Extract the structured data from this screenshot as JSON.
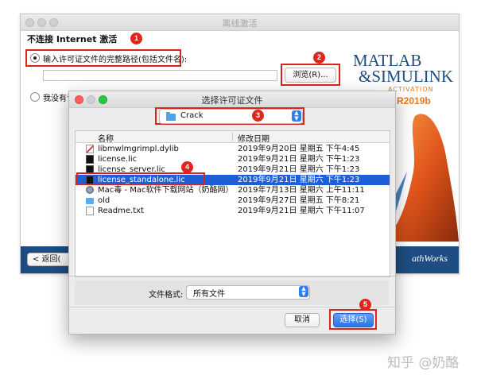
{
  "background_window": {
    "title": "离线激活",
    "heading": "不连接 Internet 激活",
    "option_license_path": "输入许可证文件的完整路径(包括文件名):",
    "option_no_license": "我没有许",
    "browse_button": "浏览(R)...",
    "back_button": "< 返回(",
    "logo_matlab": "MATLAB",
    "logo_simulink": "&SIMULINK",
    "logo_activation": "ACTIVATION",
    "logo_release": "R2019b",
    "footer_brand": "athWorks"
  },
  "dialog": {
    "title": "选择许可证文件",
    "location": "Crack",
    "columns": {
      "name": "名称",
      "modified": "修改日期"
    },
    "files": [
      {
        "name": "libmwlmgrimpl.dylib",
        "date": "2019年9月20日 星期五 下午4:45",
        "icon": "dylib-icon",
        "selected": false
      },
      {
        "name": "license.lic",
        "date": "2019年9月21日 星期六 下午1:23",
        "icon": "license-file-icon",
        "selected": false
      },
      {
        "name": "license_server.lic",
        "date": "2019年9月21日 星期六 下午1:23",
        "icon": "license-file-icon",
        "selected": false
      },
      {
        "name": "license_standalone.lic",
        "date": "2019年9月21日 星期六 下午1:23",
        "icon": "license-file-icon",
        "selected": true
      },
      {
        "name": "Mac毒 - Mac软件下载网站（奶酪网）",
        "date": "2019年7月13日 星期六 上午11:11",
        "icon": "disk-icon",
        "selected": false
      },
      {
        "name": "old",
        "date": "2019年9月27日 星期五 下午8:21",
        "icon": "folder-icon",
        "selected": false
      },
      {
        "name": "Readme.txt",
        "date": "2019年9月21日 星期六 下午11:07",
        "icon": "text-file-icon",
        "selected": false
      }
    ],
    "format_label": "文件格式:",
    "format_value": "所有文件",
    "cancel_button": "取消",
    "choose_button": "选择(S)"
  },
  "annotations": [
    "1",
    "2",
    "3",
    "4",
    "5"
  ],
  "watermark": "知乎 @奶酪",
  "colors": {
    "annotation_red": "#e0251b",
    "selection_blue": "#1f5ed9",
    "mathworks_blue": "#1d4d82",
    "mac_close": "#fd5f57",
    "mac_min": "#febc2e",
    "mac_max": "#28c840"
  }
}
